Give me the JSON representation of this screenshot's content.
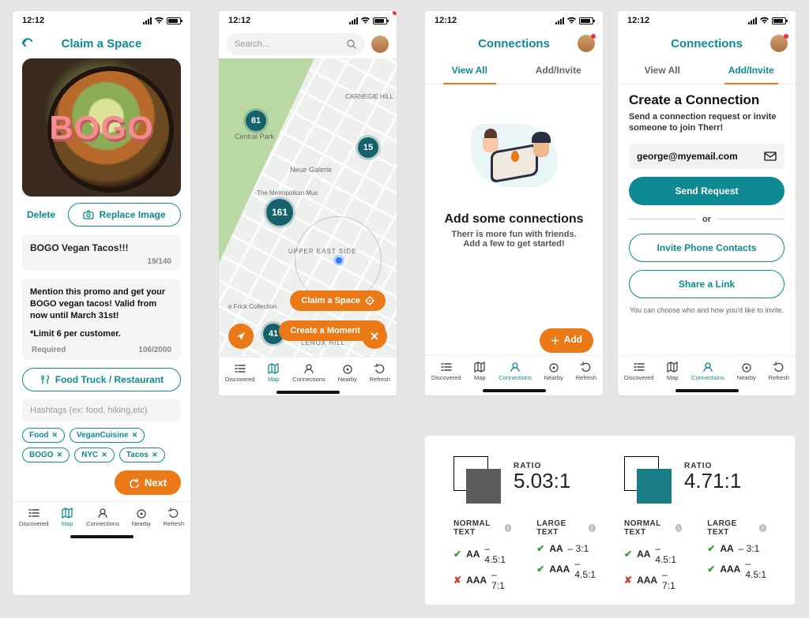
{
  "status": {
    "time": "12:12"
  },
  "nav": {
    "discovered": "Discovered",
    "map": "Map",
    "connections": "Connections",
    "nearby": "Nearby",
    "refresh": "Refresh"
  },
  "screen1": {
    "title": "Claim a Space",
    "hero_word": "BOGO",
    "delete": "Delete",
    "replace": "Replace Image",
    "name_value": "BOGO Vegan Tacos!!!",
    "name_count": "19/140",
    "desc_line1": "Mention this promo and get your BOGO vegan tacos! Valid from now until March 31st!",
    "desc_line2": "*Limit 6 per customer.",
    "required": "Required",
    "desc_count": "106/2000",
    "category": "Food Truck / Restaurant",
    "hash_placeholder": "Hashtags (ex: food, hiking,etc)",
    "tags": [
      "Food",
      "VeganCuisine",
      "BOGO",
      "NYC",
      "Tacos"
    ],
    "next": "Next"
  },
  "screen2": {
    "search_placeholder": "Search...",
    "pins": {
      "a": "81",
      "b": "15",
      "c": "161",
      "d": "41"
    },
    "labels": {
      "central_park": "Central Park",
      "neue": "Neue Galerie",
      "met": "The Metropolitan Mus",
      "ues": "UPPER EAST SIDE",
      "frick": "e Frick Collection",
      "lenox": "LENOX HILL",
      "carnegie": "CARNEGIE HILL"
    },
    "claim": "Claim a Space",
    "moment": "Create a Moment"
  },
  "screen3": {
    "title": "Connections",
    "tab_all": "View All",
    "tab_add": "Add/Invite",
    "empty_h": "Add some connections",
    "empty_p": "Therr is more fun with friends. Add a few to get started!",
    "add": "Add"
  },
  "screen4": {
    "title": "Connections",
    "tab_all": "View All",
    "tab_add": "Add/Invite",
    "h": "Create a Connection",
    "p": "Send a connection request or invite someone to join Therr!",
    "email": "george@myemail.com",
    "send": "Send Request",
    "or": "or",
    "invite_contacts": "Invite Phone Contacts",
    "share_link": "Share a Link",
    "note": "You can choose who and how you'd like to invite."
  },
  "contrast": {
    "ratio_label": "RATIO",
    "left": {
      "swatch": "#5b5d5d",
      "ratio": "5.03:1",
      "normal_h": "NORMAL TEXT",
      "large_h": "LARGE TEXT",
      "n1": {
        "ok": true,
        "bold": "AA",
        "rest": " – 4.5:1"
      },
      "n2": {
        "ok": false,
        "bold": "AAA",
        "rest": " – 7:1"
      },
      "l1": {
        "ok": true,
        "bold": "AA",
        "rest": " – 3:1"
      },
      "l2": {
        "ok": true,
        "bold": "AAA",
        "rest": " – 4.5:1"
      }
    },
    "right": {
      "swatch": "#1b7d86",
      "ratio": "4.71:1",
      "normal_h": "NORMAL TEXT",
      "large_h": "LARGE TEXT",
      "n1": {
        "ok": true,
        "bold": "AA",
        "rest": " – 4.5:1"
      },
      "n2": {
        "ok": false,
        "bold": "AAA",
        "rest": " – 7:1"
      },
      "l1": {
        "ok": true,
        "bold": "AA",
        "rest": " – 3:1"
      },
      "l2": {
        "ok": true,
        "bold": "AAA",
        "rest": " – 4.5:1"
      }
    }
  }
}
